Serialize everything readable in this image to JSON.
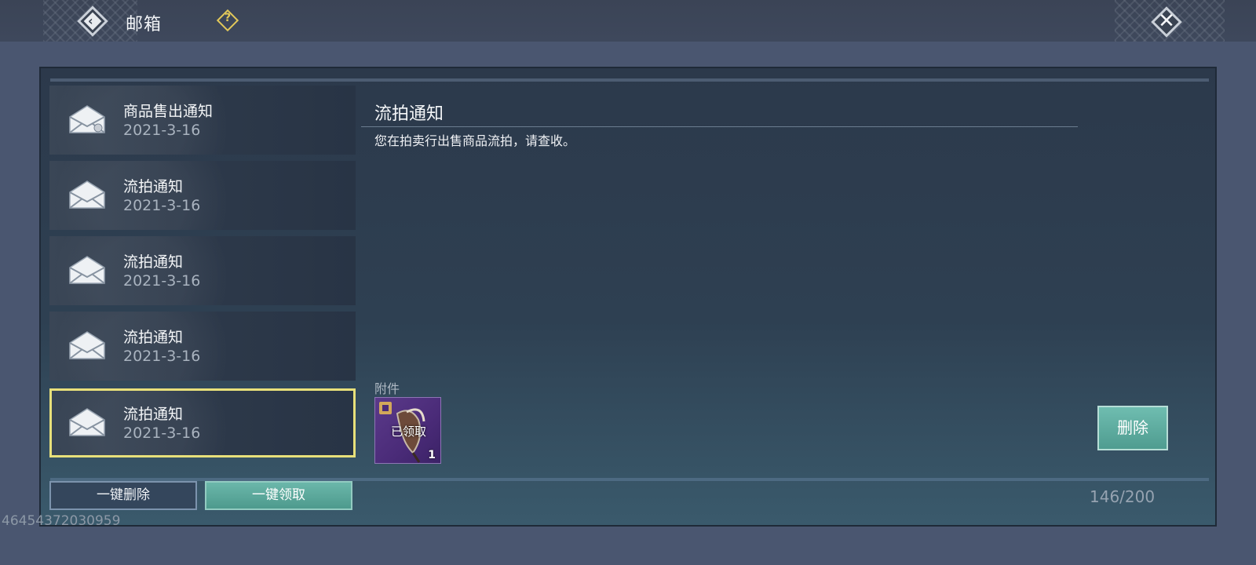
{
  "header": {
    "title": "邮箱",
    "help_symbol": "?",
    "close_symbol": "✕"
  },
  "mail_list": [
    {
      "subject": "商品售出通知",
      "date": "2021-3-16",
      "selected": false
    },
    {
      "subject": "流拍通知",
      "date": "2021-3-16",
      "selected": false
    },
    {
      "subject": "流拍通知",
      "date": "2021-3-16",
      "selected": false
    },
    {
      "subject": "流拍通知",
      "date": "2021-3-16",
      "selected": false
    },
    {
      "subject": "流拍通知",
      "date": "2021-3-16",
      "selected": true
    }
  ],
  "detail": {
    "title": "流拍通知",
    "body": "您在拍卖行出售商品流拍，请查收。",
    "attachment_label": "附件",
    "attachment": {
      "status": "已领取",
      "count": "1"
    },
    "delete_label": "删除"
  },
  "footer": {
    "delete_all_label": "一键删除",
    "claim_all_label": "一键领取",
    "mail_count": "146/200"
  },
  "uid": "46454372030959",
  "colors": {
    "selected_border": "#e8e07a",
    "accent_button": "#5aa99c",
    "attachment_bg": "#4a2b78"
  }
}
